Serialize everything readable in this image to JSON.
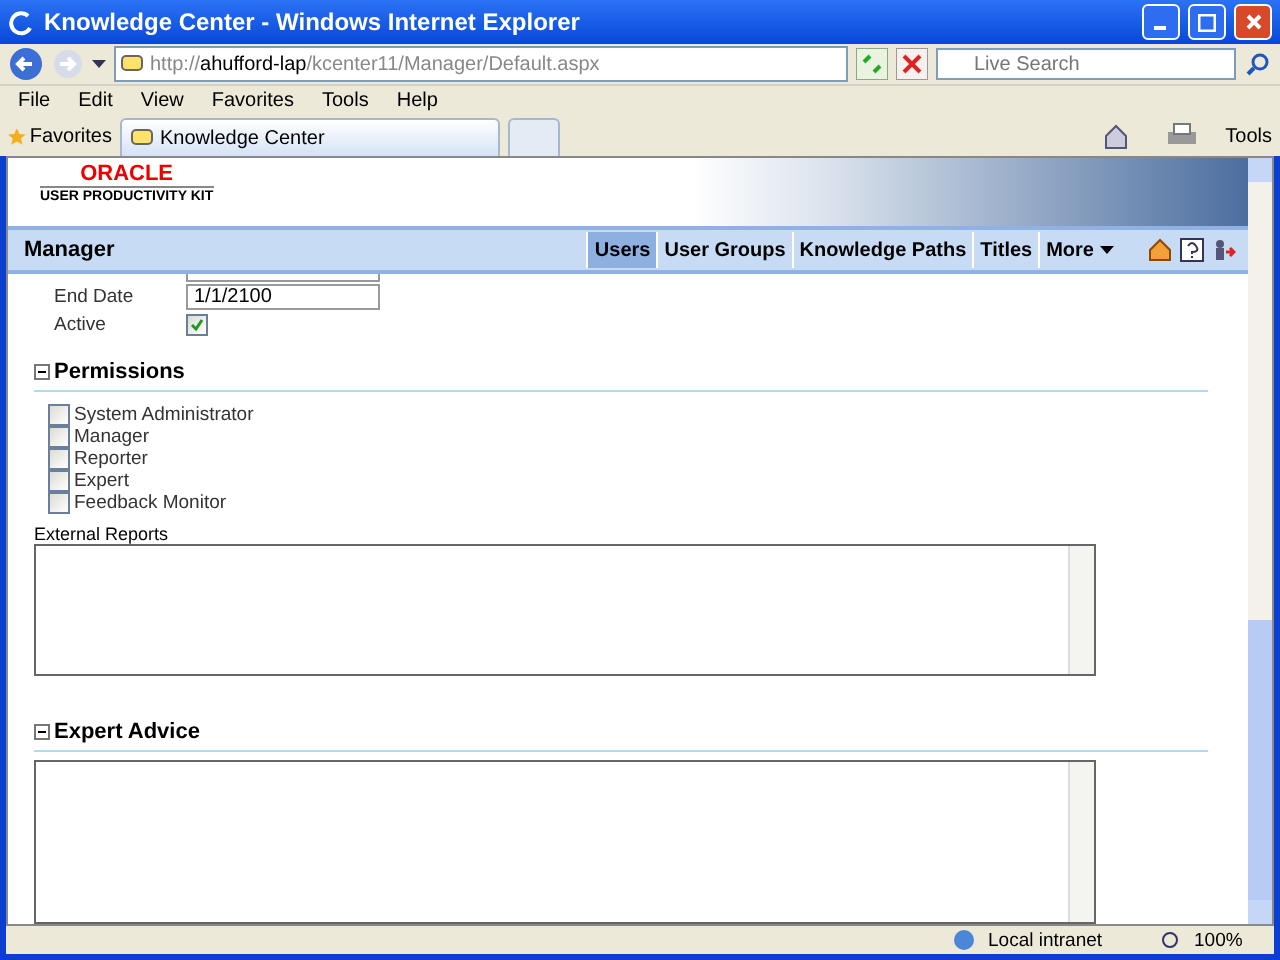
{
  "window": {
    "title": "Knowledge Center - Windows Internet Explorer"
  },
  "address_bar": {
    "scheme": "http://",
    "host": "ahufford-lap",
    "path": "/kcenter11/Manager/Default.aspx"
  },
  "search": {
    "placeholder": "Live Search"
  },
  "menu": [
    "File",
    "Edit",
    "View",
    "Favorites",
    "Tools",
    "Help"
  ],
  "favorites_bar": {
    "favorites": "Favorites",
    "tabs": [
      {
        "label": "Knowledge Center",
        "selected": true
      }
    ],
    "tools": "Tools"
  },
  "logo": {
    "brand": "ORACLE",
    "product": "USER PRODUCTIVITY KIT"
  },
  "manager_bar": {
    "title": "Manager",
    "tabs": [
      {
        "label": "Users",
        "selected": true
      },
      {
        "label": "User Groups",
        "selected": false
      },
      {
        "label": "Knowledge Paths",
        "selected": false
      },
      {
        "label": "Titles",
        "selected": false
      }
    ],
    "more": "More"
  },
  "fields": [
    {
      "kind": "text",
      "label": "End Date",
      "value": "1/1/2100"
    },
    {
      "kind": "checkbox",
      "label": "Active",
      "checked": true
    }
  ],
  "sections": [
    {
      "title": "Permissions",
      "expanded": true,
      "permissions": [
        {
          "label": "System Administrator",
          "checked": false
        },
        {
          "label": "Manager",
          "checked": false
        },
        {
          "label": "Reporter",
          "checked": false
        },
        {
          "label": "Expert",
          "checked": false
        },
        {
          "label": "Feedback Monitor",
          "checked": false
        }
      ],
      "textarea_label": "External Reports"
    },
    {
      "title": "Expert Advice",
      "expanded": true
    }
  ],
  "status_bar": {
    "zone": "Local intranet",
    "zoom": "100%"
  }
}
